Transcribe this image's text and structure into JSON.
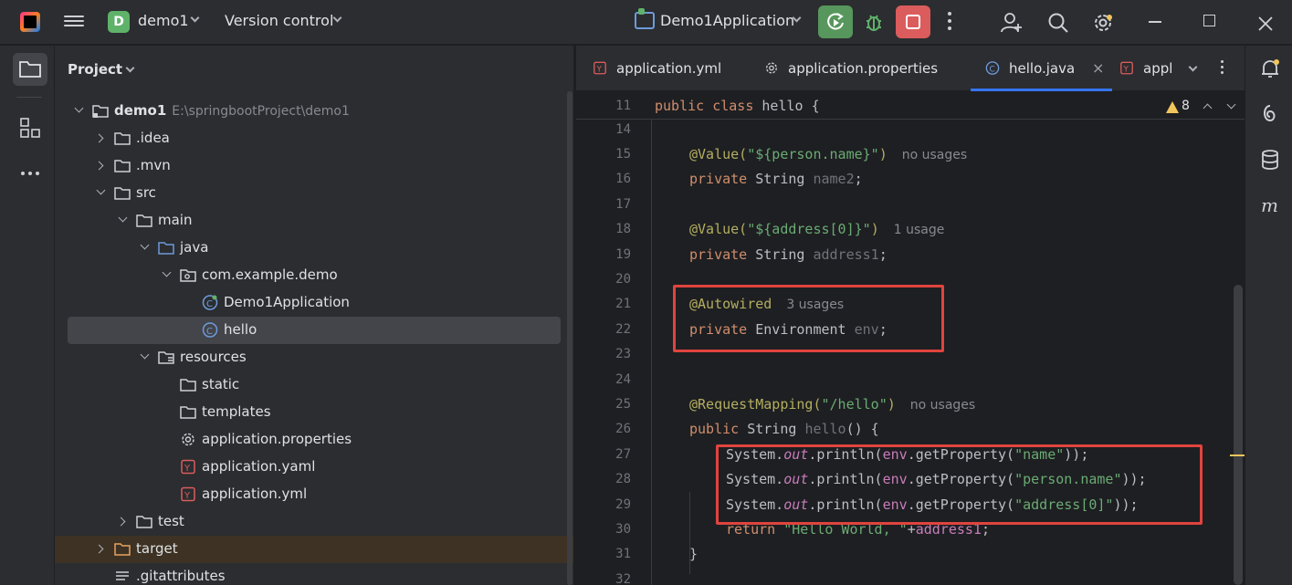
{
  "titlebar": {
    "project_badge": "D",
    "project_name": "demo1",
    "vcs_label": "Version control",
    "run_config": "Demo1Application",
    "icons": [
      "ide-logo-icon",
      "hamburger-icon",
      "run-icon",
      "debug-icon",
      "stop-icon",
      "more-icon",
      "add-user-icon",
      "search-icon",
      "settings-icon",
      "minimize-icon",
      "maximize-icon",
      "close-icon"
    ]
  },
  "toolstrip": {
    "icons": [
      "project-folder-icon",
      "structure-icon",
      "more-tools-icon"
    ]
  },
  "project_panel": {
    "title": "Project",
    "tree": [
      {
        "label": "demo1",
        "path": "E:\\springbootProject\\demo1",
        "bold": true,
        "indent": 0,
        "arrow": "open",
        "icon": "module"
      },
      {
        "label": ".idea",
        "indent": 1,
        "arrow": "closed",
        "icon": "folder"
      },
      {
        "label": ".mvn",
        "indent": 1,
        "arrow": "closed",
        "icon": "folder"
      },
      {
        "label": "src",
        "indent": 1,
        "arrow": "open",
        "icon": "folder"
      },
      {
        "label": "main",
        "indent": 2,
        "arrow": "open",
        "icon": "folder"
      },
      {
        "label": "java",
        "indent": 3,
        "arrow": "open",
        "icon": "source-folder"
      },
      {
        "label": "com.example.demo",
        "indent": 4,
        "arrow": "open",
        "icon": "package"
      },
      {
        "label": "Demo1Application",
        "indent": 5,
        "arrow": "none",
        "icon": "spring-class"
      },
      {
        "label": "hello",
        "indent": 5,
        "arrow": "none",
        "icon": "class",
        "selected": true
      },
      {
        "label": "resources",
        "indent": 3,
        "arrow": "open",
        "icon": "resource-folder"
      },
      {
        "label": "static",
        "indent": 4,
        "arrow": "none",
        "icon": "folder"
      },
      {
        "label": "templates",
        "indent": 4,
        "arrow": "none",
        "icon": "folder"
      },
      {
        "label": "application.properties",
        "indent": 4,
        "arrow": "none",
        "icon": "settings-file"
      },
      {
        "label": "application.yaml",
        "indent": 4,
        "arrow": "none",
        "icon": "yaml"
      },
      {
        "label": "application.yml",
        "indent": 4,
        "arrow": "none",
        "icon": "yaml"
      },
      {
        "label": "test",
        "indent": 2,
        "arrow": "closed",
        "icon": "folder"
      },
      {
        "label": "target",
        "indent": 1,
        "arrow": "closed",
        "icon": "excluded-folder",
        "excluded": true
      },
      {
        "label": ".gitattributes",
        "indent": 1,
        "arrow": "none",
        "icon": "text-file"
      }
    ]
  },
  "editor": {
    "tabs": [
      {
        "label": "application.yml",
        "icon": "yaml"
      },
      {
        "label": "application.properties",
        "icon": "settings"
      },
      {
        "label": "hello.java",
        "icon": "class",
        "active": true,
        "closable": true
      },
      {
        "label": "appl",
        "icon": "yaml"
      }
    ],
    "warnings_count": "8",
    "sticky_line": {
      "number": "11",
      "text": "public class hello {"
    },
    "lines": [
      {
        "n": "14",
        "tokens": []
      },
      {
        "n": "15",
        "tokens": [
          [
            "an",
            "@Value("
          ],
          [
            "st",
            "\"${person.name}\""
          ],
          [
            "an",
            ")"
          ]
        ],
        "hint": "no usages",
        "indent": 1
      },
      {
        "n": "16",
        "tokens": [
          [
            "kw",
            "private "
          ],
          [
            "pl",
            "String "
          ],
          [
            "dim",
            "name2"
          ],
          [
            "pl",
            ";"
          ]
        ],
        "indent": 1
      },
      {
        "n": "17",
        "tokens": []
      },
      {
        "n": "18",
        "tokens": [
          [
            "an",
            "@Value("
          ],
          [
            "st",
            "\"${address[0]}\""
          ],
          [
            "an",
            ")"
          ]
        ],
        "hint": "1 usage",
        "indent": 1
      },
      {
        "n": "19",
        "tokens": [
          [
            "kw",
            "private "
          ],
          [
            "pl",
            "String "
          ],
          [
            "dim",
            "address1"
          ],
          [
            "pl",
            ";"
          ]
        ],
        "indent": 1
      },
      {
        "n": "20",
        "tokens": []
      },
      {
        "n": "21",
        "tokens": [
          [
            "an",
            "@Autowired"
          ]
        ],
        "hint": "3 usages",
        "indent": 1
      },
      {
        "n": "22",
        "tokens": [
          [
            "kw",
            "private "
          ],
          [
            "pl",
            "Environment "
          ],
          [
            "dim",
            "env"
          ],
          [
            "pl",
            ";"
          ]
        ],
        "indent": 1
      },
      {
        "n": "23",
        "tokens": []
      },
      {
        "n": "24",
        "tokens": []
      },
      {
        "n": "25",
        "tokens": [
          [
            "an",
            "@RequestMapping("
          ],
          [
            "st",
            "\"/hello\""
          ],
          [
            "an",
            ")"
          ]
        ],
        "hint": "no usages",
        "indent": 1
      },
      {
        "n": "26",
        "tokens": [
          [
            "kw",
            "public "
          ],
          [
            "pl",
            "String "
          ],
          [
            "dim",
            "hello"
          ],
          [
            "pl",
            "() {"
          ]
        ],
        "indent": 1
      },
      {
        "n": "27",
        "tokens": [
          [
            "pl",
            "System."
          ],
          [
            "fd it",
            "out"
          ],
          [
            "pl",
            ".println("
          ],
          [
            "fd",
            "env"
          ],
          [
            "pl",
            ".getProperty("
          ],
          [
            "st",
            "\"name\""
          ],
          [
            "pl",
            "));"
          ]
        ],
        "indent": 2
      },
      {
        "n": "28",
        "tokens": [
          [
            "pl",
            "System."
          ],
          [
            "fd it",
            "out"
          ],
          [
            "pl",
            ".println("
          ],
          [
            "fd",
            "env"
          ],
          [
            "pl",
            ".getProperty("
          ],
          [
            "st",
            "\"person.name\""
          ],
          [
            "pl",
            "));"
          ]
        ],
        "indent": 2
      },
      {
        "n": "29",
        "tokens": [
          [
            "pl",
            "System."
          ],
          [
            "fd it",
            "out"
          ],
          [
            "pl",
            ".println("
          ],
          [
            "fd",
            "env"
          ],
          [
            "pl",
            ".getProperty("
          ],
          [
            "st",
            "\"address[0]\""
          ],
          [
            "pl",
            "));"
          ]
        ],
        "indent": 2
      },
      {
        "n": "30",
        "tokens": [
          [
            "kw",
            "return "
          ],
          [
            "st",
            "\"Hello World, \""
          ],
          [
            "pl",
            "+"
          ],
          [
            "fd",
            "address1"
          ],
          [
            "pl",
            ";"
          ]
        ],
        "indent": 2
      },
      {
        "n": "31",
        "tokens": [
          [
            "pl",
            "}"
          ]
        ],
        "indent": 1
      },
      {
        "n": "32",
        "tokens": []
      }
    ]
  },
  "right_strip": {
    "icons": [
      "notifications-icon",
      "ai-assistant-icon",
      "database-icon",
      "maven-icon"
    ]
  },
  "colors": {
    "accent": "#3574f0",
    "run": "#57965c",
    "stop": "#db5c5c",
    "highlight_box": "#e0443e",
    "warning": "#f2c55c"
  }
}
